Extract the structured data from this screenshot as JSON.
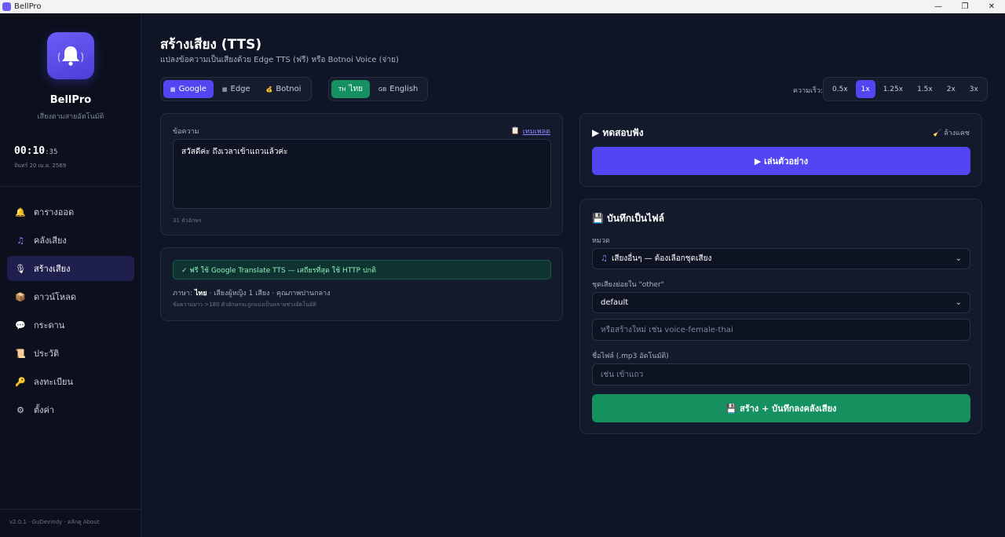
{
  "window": {
    "title": "BellPro",
    "min": "—",
    "max": "❐",
    "close": "✕"
  },
  "sidebar": {
    "brand": "BellPro",
    "subtitle": "เสียงตามสายอัตโนมัติ",
    "clock": {
      "hm": "00:10",
      "sec": ":35"
    },
    "date": "จันทร์ 20 เม.ย. 2569",
    "items": [
      {
        "label": "ตารางออด",
        "icon": "bell-icon",
        "glyph": "🔔"
      },
      {
        "label": "คลังเสียง",
        "icon": "music-note-icon",
        "glyph": "♫"
      },
      {
        "label": "สร้างเสียง",
        "icon": "microphone-icon",
        "glyph": "🎙"
      },
      {
        "label": "ดาวน์โหลด",
        "icon": "box-icon",
        "glyph": "📦"
      },
      {
        "label": "กระดาน",
        "icon": "speech-bubble-icon",
        "glyph": "💬"
      },
      {
        "label": "ประวัติ",
        "icon": "scroll-icon",
        "glyph": "📜"
      },
      {
        "label": "ลงทะเบียน",
        "icon": "key-icon",
        "glyph": "🔑"
      },
      {
        "label": "ตั้งค่า",
        "icon": "gear-icon",
        "glyph": "⚙"
      }
    ],
    "footer": "v2.0.1 · GuDevindy · คลิกดู About"
  },
  "header": {
    "title": "สร้างเสียง (TTS)",
    "subtitle": "แปลงข้อความเป็นเสียงด้วย Edge TTS (ฟรี) หรือ Botnoi Voice (จ่าย)"
  },
  "engines": [
    {
      "label": "Google",
      "mini": "▦"
    },
    {
      "label": "Edge",
      "mini": "▦"
    },
    {
      "label": "Botnoi",
      "mini": "💰"
    }
  ],
  "languages": [
    {
      "code": "TH",
      "label": "ไทย"
    },
    {
      "code": "GB",
      "label": "English"
    }
  ],
  "speed": {
    "label": "ความเร็ว:",
    "options": [
      "0.5x",
      "1x",
      "1.25x",
      "1.5x",
      "2x",
      "3x"
    ],
    "selected": "1x"
  },
  "text_card": {
    "label": "ข้อความ",
    "template_link": "เทมเพลต",
    "value": "สวัสดีค่ะ ถึงเวลาเข้าแถวแล้วค่ะ",
    "char_count": "31 ตัวอักษร"
  },
  "info_card": {
    "banner": "✓ ฟรี ใช้ Google Translate TTS — เสถียรที่สุด ใช้ HTTP ปกติ",
    "lang_prefix": "ภาษา:",
    "lang_value": "ไทย",
    "lang_rest": "· เสียงผู้หญิง 1 เสียง · คุณภาพปานกลาง",
    "note": "ข้อความยาว >180 ตัวอักษรจะถูกแบ่งเป็นหลายช่วงอัตโนมัติ"
  },
  "test_card": {
    "title": "▶ ทดสอบฟัง",
    "clear": "ล้างแคช",
    "play": "▶ เล่นตัวอย่าง"
  },
  "save_card": {
    "title": "บันทึกเป็นไฟล์",
    "category_label": "หมวด",
    "category_value": "เสียงอื่นๆ — ต้องเลือกชุดเสียง",
    "subset_label": "ชุดเสียงย่อยใน \"other\"",
    "subset_value": "default",
    "new_placeholder": "หรือสร้างใหม่ เช่น voice-female-thai",
    "filename_label": "ชื่อไฟล์ (.mp3 อัตโนมัติ)",
    "filename_placeholder": "เช่น เข้าแถว",
    "save_button": "สร้าง + บันทึกลงคลังเสียง"
  },
  "colors": {
    "accent": "#5146f2",
    "success": "#14915f",
    "bg": "#0f1524"
  }
}
